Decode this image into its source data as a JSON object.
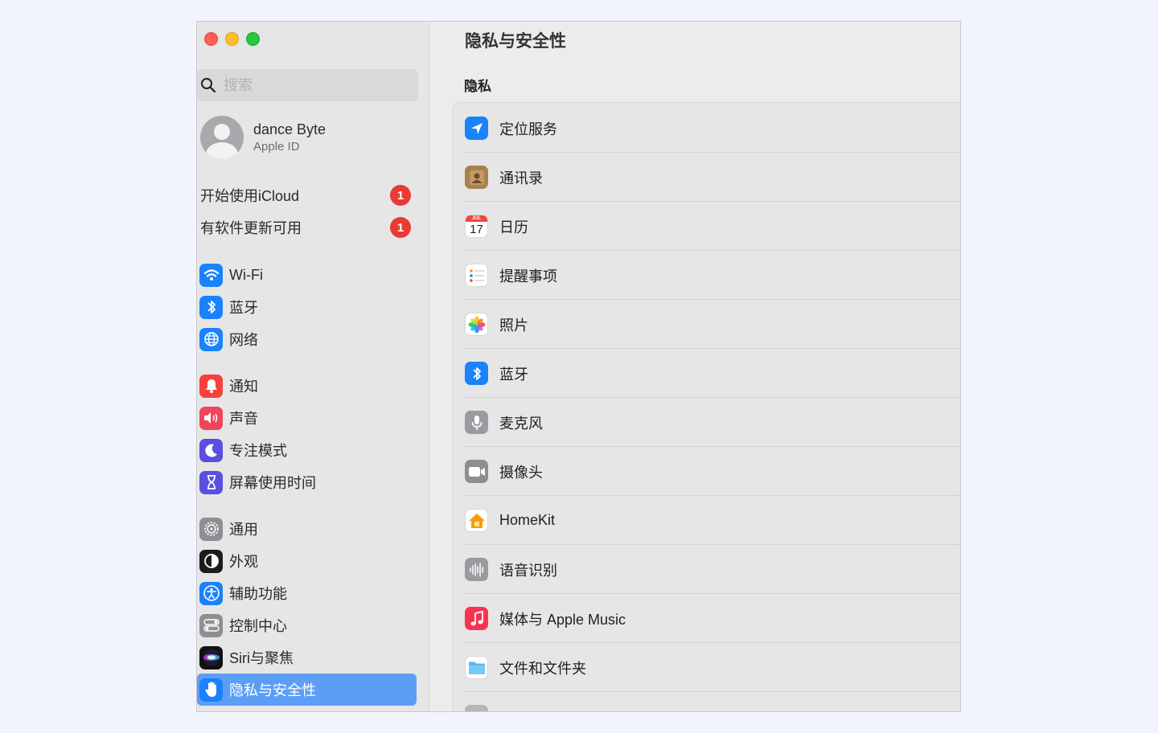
{
  "sidebar": {
    "search_placeholder": "搜索",
    "account": {
      "name": "dance Byte",
      "subtitle": "Apple ID"
    },
    "notices": [
      {
        "label": "开始使用iCloud",
        "badge": "1"
      },
      {
        "label": "有软件更新可用",
        "badge": "1"
      }
    ],
    "items": [
      {
        "label": "Wi-Fi",
        "icon": "wifi-icon"
      },
      {
        "label": "蓝牙",
        "icon": "bluetooth-icon"
      },
      {
        "label": "网络",
        "icon": "globe-icon"
      },
      {
        "label": "通知",
        "icon": "bell-icon"
      },
      {
        "label": "声音",
        "icon": "speaker-icon"
      },
      {
        "label": "专注模式",
        "icon": "moon-icon"
      },
      {
        "label": "屏幕使用时间",
        "icon": "hourglass-icon"
      },
      {
        "label": "通用",
        "icon": "gear-icon"
      },
      {
        "label": "外观",
        "icon": "appearance-icon"
      },
      {
        "label": "辅助功能",
        "icon": "accessibility-icon"
      },
      {
        "label": "控制中心",
        "icon": "control-center-icon"
      },
      {
        "label": "Siri与聚焦",
        "icon": "siri-icon"
      },
      {
        "label": "隐私与安全性",
        "icon": "hand-icon",
        "selected": true
      }
    ]
  },
  "main": {
    "title": "隐私与安全性",
    "section": "隐私",
    "rows": [
      {
        "label": "定位服务",
        "icon": "location-icon"
      },
      {
        "label": "通讯录",
        "icon": "contacts-icon"
      },
      {
        "label": "日历",
        "icon": "calendar-icon",
        "calendar_month": "JUL",
        "calendar_day": "17"
      },
      {
        "label": "提醒事项",
        "icon": "reminders-icon"
      },
      {
        "label": "照片",
        "icon": "photos-icon"
      },
      {
        "label": "蓝牙",
        "icon": "bluetooth-icon"
      },
      {
        "label": "麦克风",
        "icon": "microphone-icon"
      },
      {
        "label": "摄像头",
        "icon": "camera-icon"
      },
      {
        "label": "HomeKit",
        "icon": "home-icon"
      },
      {
        "label": "语音识别",
        "icon": "waveform-icon"
      },
      {
        "label": "媒体与 Apple Music",
        "icon": "music-icon"
      },
      {
        "label": "文件和文件夹",
        "icon": "folder-icon"
      }
    ]
  },
  "colors": {
    "accent": "#5c9ef6",
    "badge": "#ea3a34",
    "close": "#fe5f57",
    "minimize": "#febc2e",
    "maximize": "#28c840"
  }
}
